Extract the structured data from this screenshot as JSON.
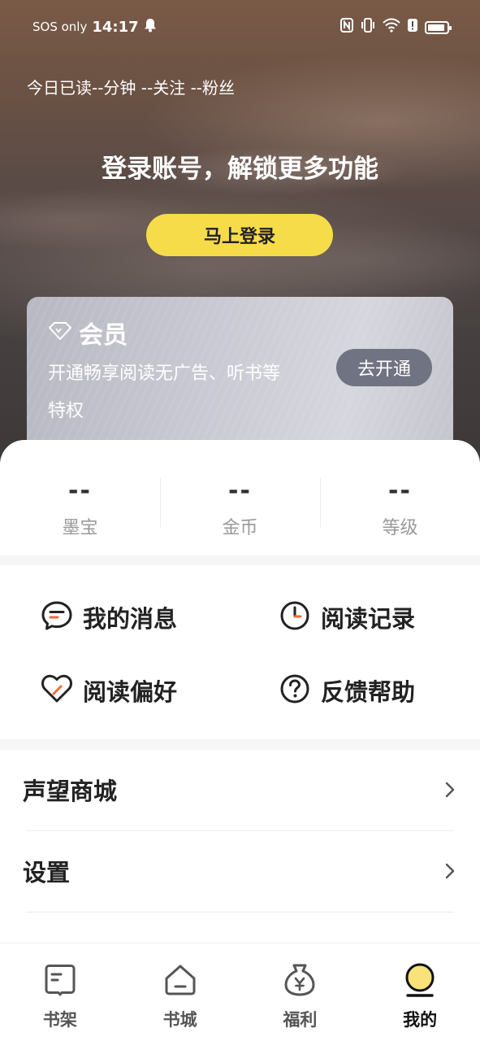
{
  "status_bar": {
    "carrier": "SOS only",
    "time": "14:17"
  },
  "header": {
    "reading_stats": "今日已读--分钟 --关注 --粉丝",
    "login_title": "登录账号，解锁更多功能",
    "login_button": "马上登录"
  },
  "vip": {
    "title": "会员",
    "description": "开通畅享阅读无广告、听书等特权",
    "open_button": "去开通"
  },
  "stats": [
    {
      "value": "--",
      "label": "墨宝"
    },
    {
      "value": "--",
      "label": "金币"
    },
    {
      "value": "--",
      "label": "等级"
    }
  ],
  "quick_actions": [
    {
      "label": "我的消息",
      "icon": "message-icon"
    },
    {
      "label": "阅读记录",
      "icon": "clock-icon"
    },
    {
      "label": "阅读偏好",
      "icon": "heart-icon"
    },
    {
      "label": "反馈帮助",
      "icon": "help-icon"
    }
  ],
  "menu": [
    {
      "label": "声望商城"
    },
    {
      "label": "设置"
    }
  ],
  "tabs": [
    {
      "label": "书架",
      "icon": "bookshelf-icon"
    },
    {
      "label": "书城",
      "icon": "bookstore-icon"
    },
    {
      "label": "福利",
      "icon": "money-bag-icon"
    },
    {
      "label": "我的",
      "icon": "profile-icon",
      "active": true
    }
  ],
  "colors": {
    "accent": "#f7dc4a",
    "accent_orange": "#f26a3c",
    "vip_button": "#707381"
  }
}
